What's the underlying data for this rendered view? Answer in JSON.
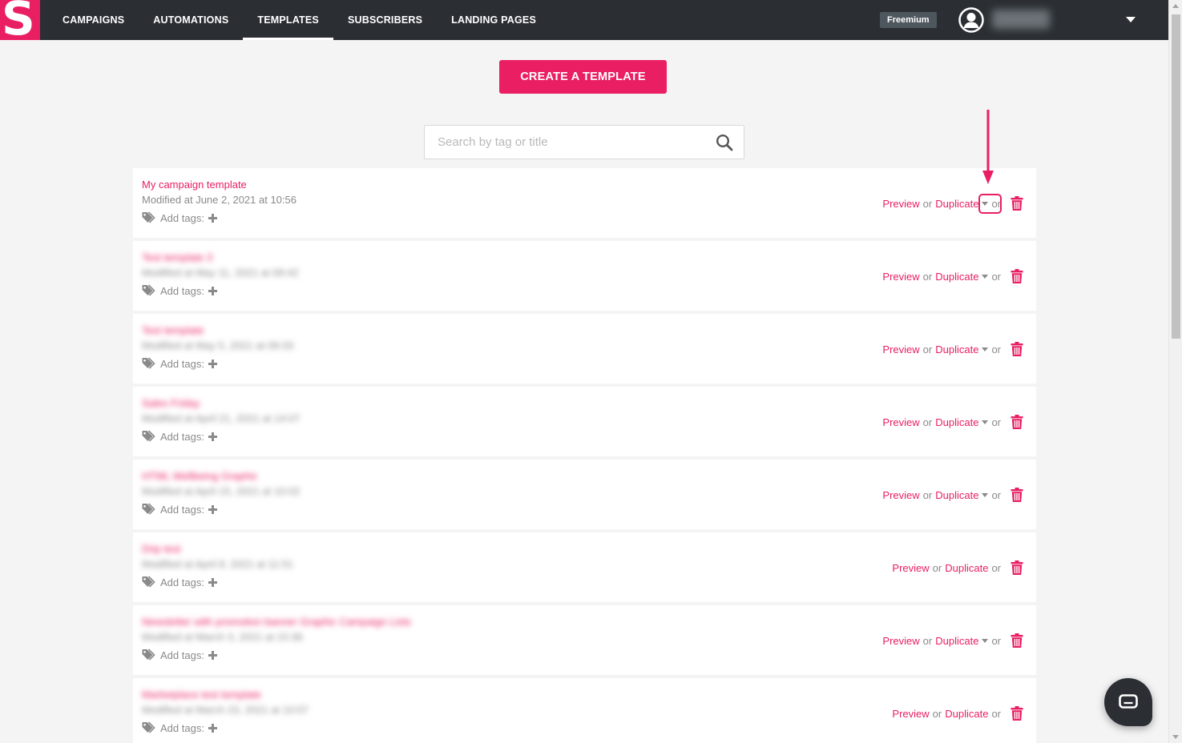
{
  "app": {
    "logo_letter": "S",
    "brand_color": "#e91e63"
  },
  "nav": {
    "items": [
      "CAMPAIGNS",
      "AUTOMATIONS",
      "TEMPLATES",
      "SUBSCRIBERS",
      "LANDING PAGES"
    ],
    "active": "TEMPLATES"
  },
  "account": {
    "plan_badge": "Freemium",
    "avatar_icon": "user-circle-icon",
    "menu_icon": "chevron-down-icon"
  },
  "page": {
    "create_button": "CREATE A TEMPLATE",
    "search_placeholder": "Search by tag or title",
    "search_icon": "search-icon"
  },
  "row_labels": {
    "add_tags": "Add tags:",
    "preview": "Preview",
    "or": "or",
    "duplicate": "Duplicate"
  },
  "templates": [
    {
      "title": "My campaign template",
      "modified": "Modified at June 2, 2021 at 10:56",
      "blurred": false,
      "has_dropdown": true
    },
    {
      "title": "Test template 3",
      "modified": "Modified at May 11, 2021 at 09:42",
      "blurred": true,
      "has_dropdown": true
    },
    {
      "title": "Test template",
      "modified": "Modified at May 5, 2021 at 09:33",
      "blurred": true,
      "has_dropdown": true
    },
    {
      "title": "Sales Friday",
      "modified": "Modified at April 21, 2021 at 14:07",
      "blurred": true,
      "has_dropdown": true
    },
    {
      "title": "HTML Wellbeing Graphic",
      "modified": "Modified at April 15, 2021 at 10:02",
      "blurred": true,
      "has_dropdown": true
    },
    {
      "title": "Drip test",
      "modified": "Modified at April 8, 2021 at 11:51",
      "blurred": true,
      "has_dropdown": false
    },
    {
      "title": "Newsletter with promotion banner Graphic Campaign Lists",
      "modified": "Modified at March 3, 2021 at 15:36",
      "blurred": true,
      "has_dropdown": true
    },
    {
      "title": "Marketplace test template",
      "modified": "Modified at March 23, 2021 at 10:07",
      "blurred": true,
      "has_dropdown": false
    }
  ]
}
